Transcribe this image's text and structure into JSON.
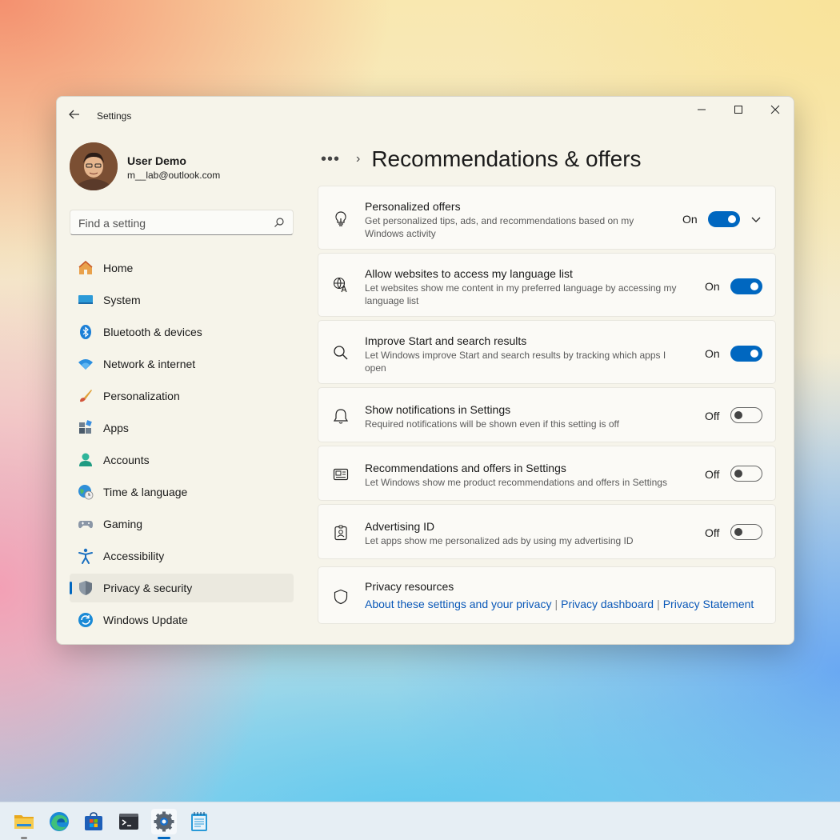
{
  "window": {
    "title": "Settings"
  },
  "user": {
    "name": "User Demo",
    "email": "m__lab@outlook.com"
  },
  "search": {
    "placeholder": "Find a setting"
  },
  "sidebar": {
    "items": [
      {
        "label": "Home",
        "icon": "home-icon",
        "selected": false
      },
      {
        "label": "System",
        "icon": "system-icon",
        "selected": false
      },
      {
        "label": "Bluetooth & devices",
        "icon": "bluetooth-icon",
        "selected": false
      },
      {
        "label": "Network & internet",
        "icon": "wifi-icon",
        "selected": false
      },
      {
        "label": "Personalization",
        "icon": "brush-icon",
        "selected": false
      },
      {
        "label": "Apps",
        "icon": "apps-icon",
        "selected": false
      },
      {
        "label": "Accounts",
        "icon": "accounts-icon",
        "selected": false
      },
      {
        "label": "Time & language",
        "icon": "globe-clock-icon",
        "selected": false
      },
      {
        "label": "Gaming",
        "icon": "gamepad-icon",
        "selected": false
      },
      {
        "label": "Accessibility",
        "icon": "accessibility-icon",
        "selected": false
      },
      {
        "label": "Privacy & security",
        "icon": "shield-icon",
        "selected": true
      },
      {
        "label": "Windows Update",
        "icon": "update-icon",
        "selected": false
      }
    ]
  },
  "breadcrumb": {
    "dots": "•••",
    "separator": "›",
    "title": "Recommendations & offers"
  },
  "settings": [
    {
      "title": "Personalized offers",
      "description": "Get personalized tips, ads, and recommendations based on my Windows activity",
      "state": "On",
      "on": true,
      "expandable": true,
      "icon": "lightbulb-icon"
    },
    {
      "title": "Allow websites to access my language list",
      "description": "Let websites show me content in my preferred language by accessing my language list",
      "state": "On",
      "on": true,
      "icon": "language-icon"
    },
    {
      "title": "Improve Start and search results",
      "description": "Let Windows improve Start and search results by tracking which apps I open",
      "state": "On",
      "on": true,
      "icon": "search-icon"
    },
    {
      "title": "Show notifications in Settings",
      "description": "Required notifications will be shown even if this setting is off",
      "state": "Off",
      "on": false,
      "icon": "bell-icon"
    },
    {
      "title": "Recommendations and offers in Settings",
      "description": "Let Windows show me product recommendations and offers in Settings",
      "state": "Off",
      "on": false,
      "icon": "offers-icon"
    },
    {
      "title": "Advertising ID",
      "description": "Let apps show me personalized ads by using my advertising ID",
      "state": "Off",
      "on": false,
      "icon": "id-badge-icon"
    }
  ],
  "privacy_resources": {
    "title": "Privacy resources",
    "links": [
      "About these settings and your privacy",
      "Privacy dashboard",
      "Privacy Statement"
    ],
    "separator": "|"
  },
  "taskbar": {
    "items": [
      {
        "name": "file-explorer-icon",
        "active": false,
        "running": true
      },
      {
        "name": "edge-icon",
        "active": false,
        "running": false
      },
      {
        "name": "store-icon",
        "active": false,
        "running": false
      },
      {
        "name": "terminal-icon",
        "active": false,
        "running": false
      },
      {
        "name": "settings-icon",
        "active": true,
        "running": true
      },
      {
        "name": "notepad-icon",
        "active": false,
        "running": false
      }
    ]
  },
  "colors": {
    "accent": "#0067c0",
    "link": "#0a58b8"
  }
}
